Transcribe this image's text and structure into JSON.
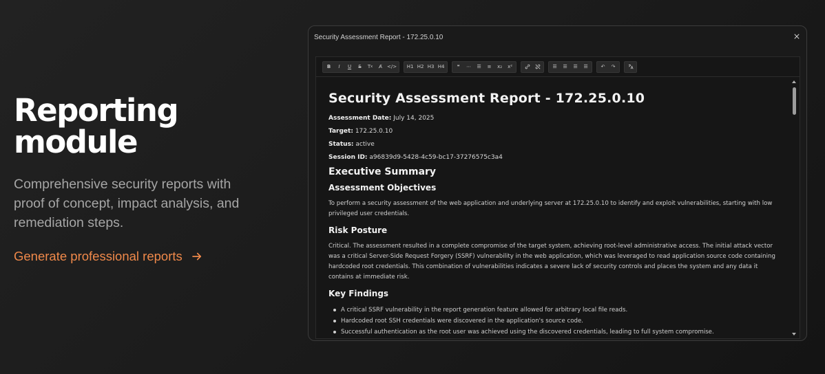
{
  "hero": {
    "title_line1": "Reporting",
    "title_line2": "module",
    "subtitle": "Comprehensive security reports with proof of concept, impact analysis, and remediation steps.",
    "cta_label": "Generate professional reports",
    "accent_color": "#f0894a"
  },
  "window": {
    "title": "Security Assessment Report - 172.25.0.10"
  },
  "toolbar": {
    "groups": [
      [
        "B",
        "I",
        "U",
        "S",
        "Tx",
        "A",
        "</>"
      ],
      [
        "H1",
        "H2",
        "H3",
        "H4"
      ],
      [
        "quote",
        "hr",
        "ul",
        "ol",
        "x₂",
        "x²"
      ],
      [
        "link",
        "unlink"
      ],
      [
        "align-left",
        "align-center",
        "align-right",
        "justify"
      ],
      [
        "undo",
        "redo"
      ],
      [
        "translate"
      ]
    ]
  },
  "report": {
    "title": "Security Assessment Report - 172.25.0.10",
    "date_label": "Assessment Date:",
    "date_value": "July 14, 2025",
    "target_label": "Target:",
    "target_value": "172.25.0.10",
    "status_label": "Status:",
    "status_value": "active",
    "session_label": "Session ID:",
    "session_value": "a96839d9-5428-4c59-bc17-37276575c3a4",
    "exec_summary": "Executive Summary",
    "objectives_heading": "Assessment Objectives",
    "objectives_text": "To perform a security assessment of the web application and underlying server at 172.25.0.10 to identify and exploit vulnerabilities, starting with low privileged user credentials.",
    "risk_heading": "Risk Posture",
    "risk_text": "Critical. The assessment resulted in a complete compromise of the target system, achieving root-level administrative access. The initial attack vector was a critical Server-Side Request Forgery (SSRF) vulnerability in the web application, which was leveraged to read application source code containing hardcoded root credentials. This combination of vulnerabilities indicates a severe lack of security controls and places the system and any data it contains at immediate risk.",
    "findings_heading": "Key Findings",
    "findings": [
      "A critical SSRF vulnerability in the report generation feature allowed for arbitrary local file reads.",
      "Hardcoded root SSH credentials were discovered in the application's source code.",
      "Successful authentication as the root user was achieved using the discovered credentials, leading to full system compromise."
    ]
  }
}
